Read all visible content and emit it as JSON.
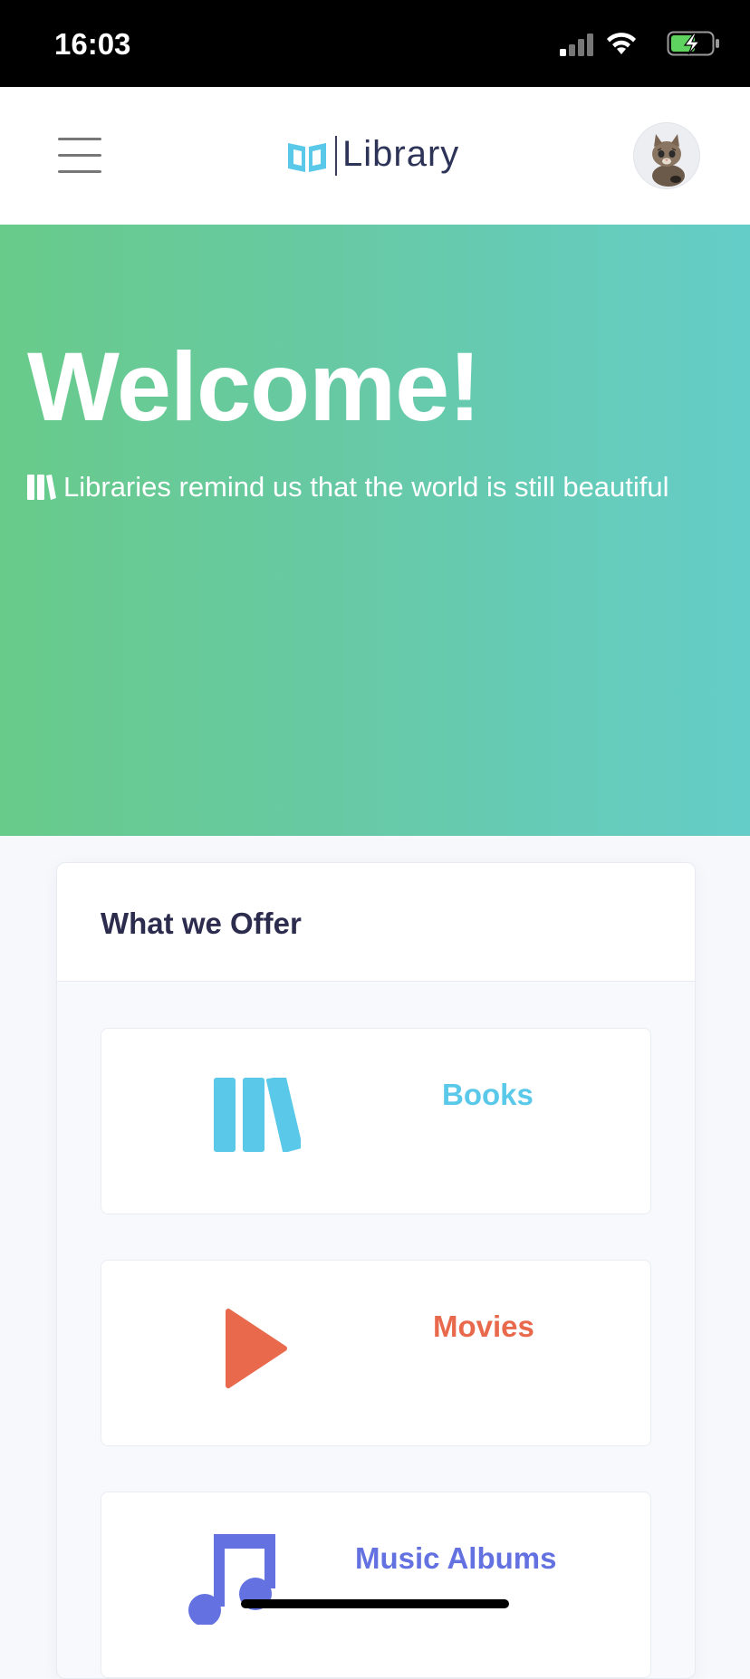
{
  "status_bar": {
    "time": "16:03"
  },
  "header": {
    "app_name": "Library"
  },
  "hero": {
    "title": "Welcome!",
    "subtitle": "Libraries remind us that the world is still beautiful"
  },
  "offers": {
    "title": "What we Offer",
    "items": [
      {
        "label": "Books",
        "color": "#5ac8e8",
        "icon": "books-icon"
      },
      {
        "label": "Movies",
        "color": "#e8694b",
        "icon": "play-icon"
      },
      {
        "label": "Music Albums",
        "color": "#6471e0",
        "icon": "music-note-icon"
      }
    ]
  },
  "colors": {
    "hero_gradient_start": "#68cb8a",
    "hero_gradient_end": "#65cdc8",
    "brand_icon": "#5ac8e8",
    "title_text": "#2c2c4f"
  }
}
